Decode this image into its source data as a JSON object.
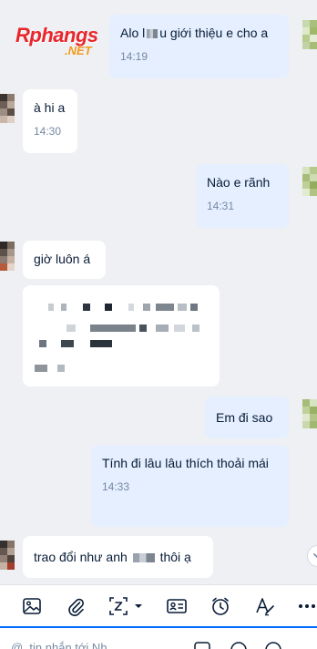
{
  "watermark": {
    "brand": "Rphangs",
    "suffix": ".NET",
    "colors": {
      "brand": "#e8262b",
      "suffix": "#f39a1e"
    }
  },
  "messages": [
    {
      "side": "out",
      "text_before": "Alo l",
      "text_after": "u giới thiệu e cho a",
      "time": "14:19"
    },
    {
      "side": "in",
      "text": "à hi a",
      "time": "14:30"
    },
    {
      "side": "out",
      "text": "Nào e rãnh",
      "time": "14:31"
    },
    {
      "side": "in",
      "text": "giờ luôn á"
    },
    {
      "side": "in",
      "redacted": true
    },
    {
      "side": "out",
      "text": "Em đi sao"
    },
    {
      "side": "out",
      "text": "Tính đi lâu lâu thích thoải mái",
      "time": "14:33"
    },
    {
      "side": "in",
      "text_before": "trao đổi như anh",
      "text_after": "thôi ạ"
    }
  ],
  "toolbar": {
    "icons": [
      "image-icon",
      "attachment-icon",
      "screenshot-icon",
      "dropdown-caret-icon",
      "contact-card-icon",
      "reminder-clock-icon",
      "text-format-icon",
      "more-icon"
    ]
  },
  "input": {
    "placeholder": "@, tin nhắn tới Nh..."
  },
  "colors": {
    "chat_bg": "#eef0f3",
    "bubble_in": "#ffffff",
    "bubble_out": "#e5efff",
    "text": "#081c36",
    "time": "#7589a3",
    "accent": "#0068ff"
  }
}
